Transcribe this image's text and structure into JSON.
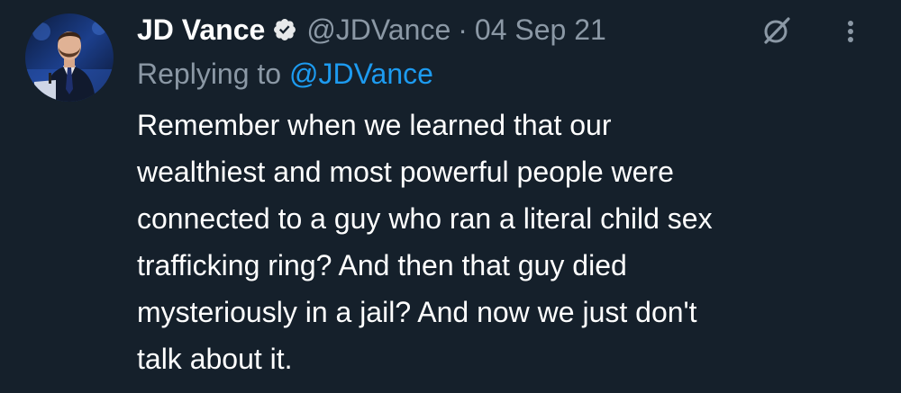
{
  "tweet": {
    "author_name": "JD Vance",
    "handle": "@JDVance",
    "separator": "·",
    "date": "04 Sep 21",
    "reply_prefix": "Replying to",
    "reply_to": "@JDVance",
    "text_lines": [
      "Remember when we learned that our",
      "wealthiest and most powerful people were",
      "connected to a guy who ran a literal child sex",
      "trafficking ring? And then that guy died",
      "mysteriously in a jail? And now we just don't",
      "talk about it."
    ]
  },
  "icons": {
    "verified": "verified-badge-icon",
    "grok": "grok-icon",
    "more": "more-options-icon"
  },
  "colors": {
    "background": "#15202b",
    "primary_text": "#ffffff",
    "secondary_text": "#8b98a5",
    "link": "#1d9bf0"
  }
}
